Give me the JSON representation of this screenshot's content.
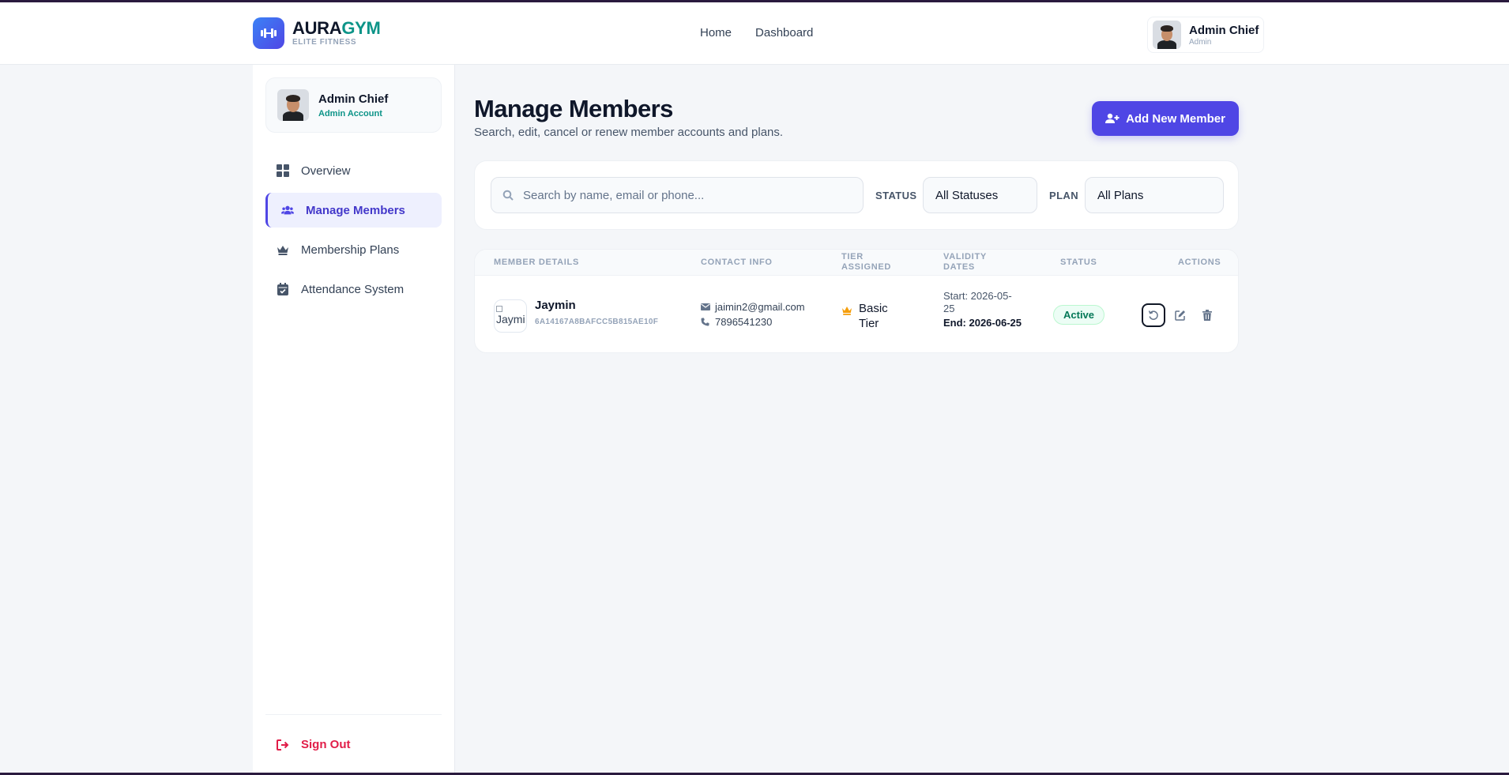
{
  "brand": {
    "name_part1": "AURA",
    "name_part2": "GYM",
    "tagline": "ELITE FITNESS"
  },
  "topnav": {
    "home": "Home",
    "dashboard": "Dashboard"
  },
  "user": {
    "name": "Admin Chief",
    "role": "Admin"
  },
  "sidebar": {
    "profile": {
      "name": "Admin Chief",
      "role": "Admin Account"
    },
    "items": [
      {
        "label": "Overview",
        "icon": "grid-icon"
      },
      {
        "label": "Manage Members",
        "icon": "users-icon",
        "active": true
      },
      {
        "label": "Membership Plans",
        "icon": "crown-icon"
      },
      {
        "label": "Attendance System",
        "icon": "calendar-check-icon"
      }
    ],
    "sign_out": "Sign Out"
  },
  "page": {
    "title": "Manage Members",
    "subtitle": "Search, edit, cancel or renew member accounts and plans.",
    "add_button": "Add New Member"
  },
  "filters": {
    "search_placeholder": "Search by name, email or phone...",
    "search_value": "",
    "status_label": "STATUS",
    "status_value": "All Statuses",
    "plan_label": "PLAN",
    "plan_value": "All Plans"
  },
  "table": {
    "headers": {
      "member": "MEMBER DETAILS",
      "contact": "CONTACT INFO",
      "tier_line1": "TIER",
      "tier_line2": "ASSIGNED",
      "validity_line1": "VALIDITY",
      "validity_line2": "DATES",
      "status": "STATUS",
      "actions": "ACTIONS"
    },
    "rows": [
      {
        "avatar_alt": "Jaymi",
        "name": "Jaymin",
        "id": "6A14167A8BAFCC5B815AE10F",
        "email": "jaimin2@gmail.com",
        "phone": "7896541230",
        "tier": "Basic Tier",
        "start": "Start: 2026-05-25",
        "end": "End: 2026-06-25",
        "status": "Active"
      }
    ]
  },
  "colors": {
    "accent": "#4f46e5",
    "brand_teal": "#0d9488",
    "danger": "#e11d48",
    "success": "#047857",
    "tier_gold": "#f59e0b"
  }
}
